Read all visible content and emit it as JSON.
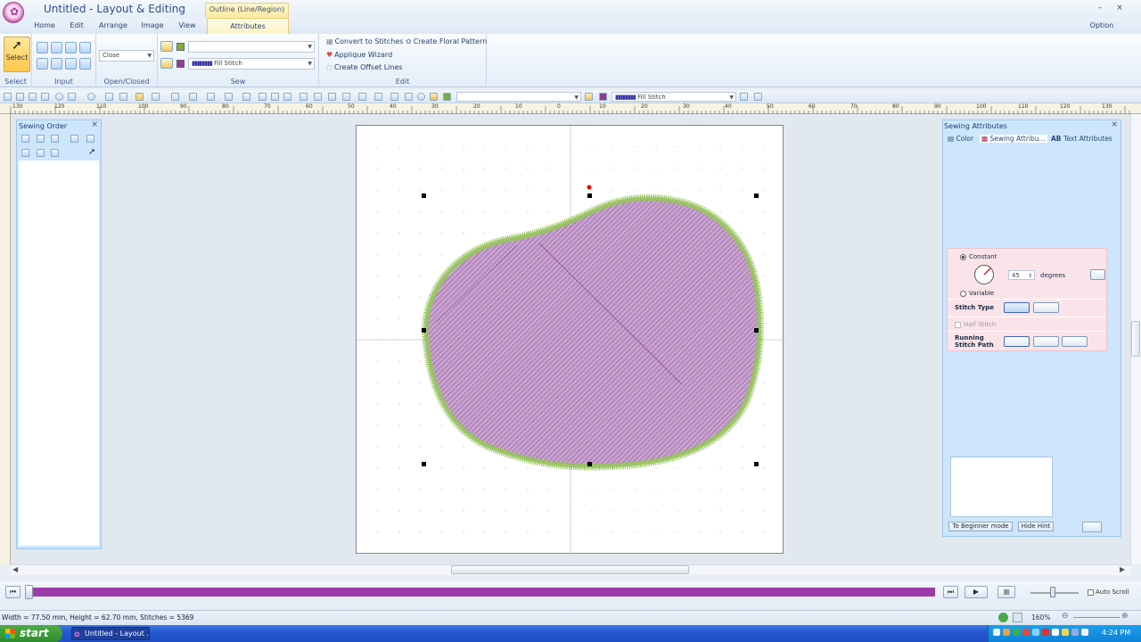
{
  "window": {
    "title": "Untitled - Layout & Editing",
    "context_group": "Outline (Line/Region)",
    "option_label": "Option",
    "min_glyph": "–",
    "close_glyph": "×"
  },
  "tabs": [
    "Home",
    "Edit",
    "Arrange",
    "Image",
    "View",
    "Attributes"
  ],
  "ribbon": {
    "select_label": "Select",
    "groups": [
      "Select",
      "Input",
      "Open/Closed",
      "Sew",
      "Edit"
    ],
    "open_closed_value": "Close",
    "sew_line_value": "",
    "sew_fill_value": "Fill Stitch",
    "sew_line_color": "#7ab03c",
    "sew_fill_color": "#8e3a9a",
    "edit_items": [
      "Convert to Stitches",
      "Create Floral Pattern",
      "Applique Wizard",
      "Create Offset Lines"
    ]
  },
  "toolbar": {
    "fill_value": "Fill Stitch"
  },
  "ruler": {
    "labels": [
      "130",
      "120",
      "110",
      "100",
      "90",
      "80",
      "70",
      "60",
      "50",
      "40",
      "30",
      "20",
      "10",
      "0",
      "10",
      "20",
      "30",
      "40",
      "50",
      "60",
      "70",
      "80",
      "90",
      "100",
      "110",
      "120",
      "130"
    ]
  },
  "sewing_order": {
    "title": "Sewing Order"
  },
  "attributes_panel": {
    "title": "Sewing Attributes",
    "tabs": [
      "Color",
      "Sewing Attribu...",
      "Text Attributes"
    ],
    "constant_label": "Constant",
    "angle_value": "45",
    "degrees_label": "degrees",
    "variable_label": "Variable",
    "stitch_type_label": "Stitch Type",
    "half_stitch_label": "Half Stitch",
    "running_path_label": "Running Stitch Path",
    "beginner_btn": "To Beginner mode",
    "hide_hint_btn": "Hide Hint"
  },
  "design": {
    "fill_color": "#b88cc0",
    "border_color": "#95c35c"
  },
  "player": {
    "progress": 1.0,
    "progress_color": "#9b3aa9",
    "auto_scroll_label": "Auto Scroll"
  },
  "status": {
    "text": "Width = 77.50 mm, Height = 62.70 mm, Stitches = 5369",
    "zoom": "160%"
  },
  "taskbar": {
    "start": "start",
    "task": "Untitled - Layout ...",
    "clock": "4:24 PM"
  }
}
